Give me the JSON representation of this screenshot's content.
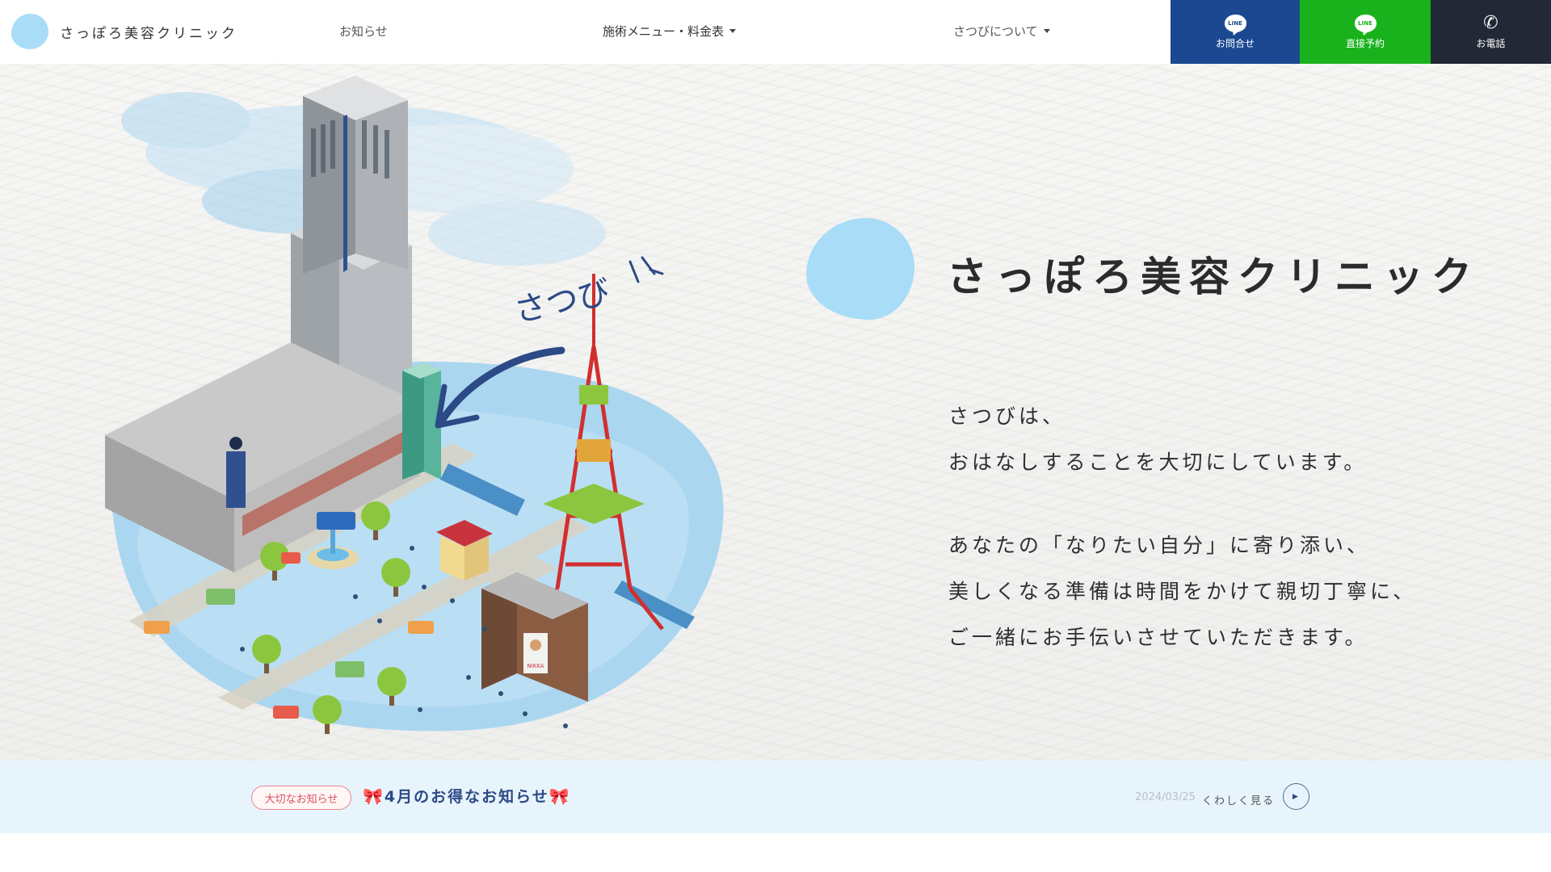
{
  "header": {
    "logo_text": "さっぽろ美容クリニック",
    "nav": {
      "news": "お知らせ",
      "menu": "施術メニュー・料金表",
      "about": "さつびについて"
    },
    "buttons": {
      "contact": {
        "icon_text": "LINE",
        "label": "お問合せ"
      },
      "reserve": {
        "icon_text": "LINE",
        "label": "直接予約"
      },
      "phone": {
        "icon": "phone-icon",
        "label": "お電話"
      }
    }
  },
  "hero": {
    "illust_label": "さつび",
    "sign_text": "NIKKA",
    "title": "さっぽろ美容クリニック",
    "copy": [
      "さつびは、",
      "おはなしすることを大切にしています。",
      "あなたの「なりたい自分」に寄り添い、",
      "美しくなる準備は時間をかけて親切丁寧に、",
      "ご一緒にお手伝いさせていただきます。"
    ]
  },
  "news": {
    "badge": "大切なお知らせ",
    "title": "4月のお得なお知らせ",
    "date": "2024/03/25",
    "more": "くわしく見る"
  },
  "colors": {
    "accent_blue": "#1b4891",
    "line_green": "#19b21d",
    "dark": "#222836",
    "blob": "#a8dcf7",
    "news_bg": "#e8f4fb"
  }
}
